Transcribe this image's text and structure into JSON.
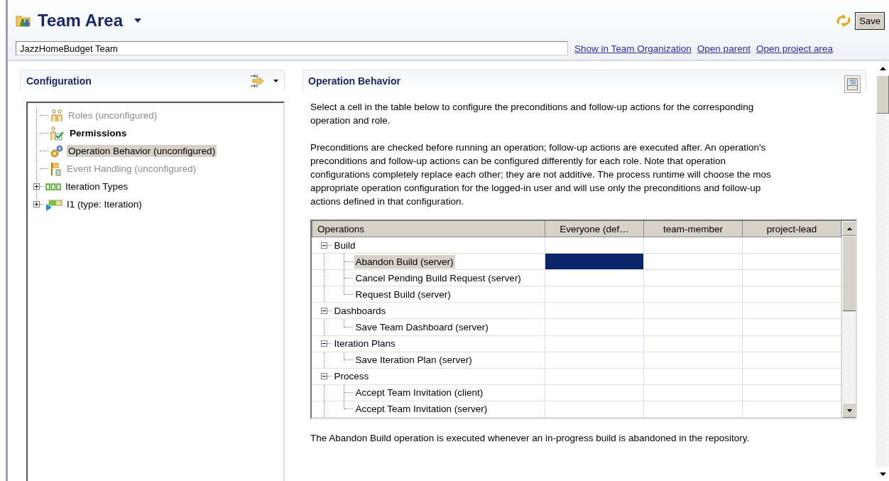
{
  "editor": {
    "title": "Team Area",
    "save_button": "Save",
    "name_field": {
      "value": "JazzHomeBudget Team"
    },
    "links": [
      "Show in Team Organization",
      "Open parent",
      "Open project area"
    ]
  },
  "configuration": {
    "title": "Configuration",
    "tree": [
      {
        "label": "Roles (unconfigured)",
        "kind": "roles",
        "disabled": true,
        "bold": false,
        "selected": false
      },
      {
        "label": "Permissions",
        "kind": "permissions",
        "disabled": false,
        "bold": true,
        "selected": false
      },
      {
        "label": "Operation Behavior (unconfigured)",
        "kind": "operations",
        "disabled": false,
        "bold": false,
        "selected": true
      },
      {
        "label": "Event Handling (unconfigured)",
        "kind": "events",
        "disabled": true,
        "bold": false,
        "selected": false
      },
      {
        "label": "Iteration Types",
        "kind": "iteration-types",
        "disabled": false,
        "bold": false,
        "selected": false,
        "expanded": false
      },
      {
        "label": "I1 (type: Iteration)",
        "kind": "iteration",
        "disabled": false,
        "bold": false,
        "selected": false,
        "expanded": false
      }
    ]
  },
  "operation_behavior": {
    "title": "Operation Behavior",
    "intro": [
      "Select a cell in the table below to configure the preconditions and follow-up actions for the corresponding",
      " operation and role."
    ],
    "details": [
      "Preconditions are checked before running an operation; follow-up actions are executed after. An operation's",
      " preconditions and follow-up actions can be configured differently for each role. Note that operation",
      " configurations completely replace each other; they are not additive. The process runtime will choose the mos",
      " appropriate operation configuration for the logged-in user and will use only the preconditions and follow-up",
      " actions defined in that configuration."
    ],
    "table": {
      "columns": [
        "Operations",
        "Everyone (def…",
        "team-member",
        "project-lead"
      ],
      "rows": [
        {
          "label": "Build",
          "expanded": true,
          "selected": false,
          "cells": [
            {
              "selected": false
            },
            {
              "selected": false
            },
            {
              "selected": false
            }
          ],
          "children": [
            {
              "label": "Abandon Build (server)",
              "selected": true,
              "cells": [
                {
                  "selected": true
                },
                {
                  "selected": false
                },
                {
                  "selected": false
                }
              ]
            },
            {
              "label": "Cancel Pending Build Request (server)",
              "selected": false,
              "cells": [
                {
                  "selected": false
                },
                {
                  "selected": false
                },
                {
                  "selected": false
                }
              ]
            },
            {
              "label": "Request Build (server)",
              "selected": false,
              "cells": [
                {
                  "selected": false
                },
                {
                  "selected": false
                },
                {
                  "selected": false
                }
              ]
            }
          ]
        },
        {
          "label": "Dashboards",
          "expanded": true,
          "selected": false,
          "cells": [
            {
              "selected": false
            },
            {
              "selected": false
            },
            {
              "selected": false
            }
          ],
          "children": [
            {
              "label": "Save Team Dashboard (server)",
              "selected": false,
              "cells": [
                {
                  "selected": false
                },
                {
                  "selected": false
                },
                {
                  "selected": false
                }
              ]
            }
          ]
        },
        {
          "label": "Iteration Plans",
          "expanded": true,
          "selected": false,
          "cells": [
            {
              "selected": false
            },
            {
              "selected": false
            },
            {
              "selected": false
            }
          ],
          "children": [
            {
              "label": "Save Iteration Plan (server)",
              "selected": false,
              "cells": [
                {
                  "selected": false
                },
                {
                  "selected": false
                },
                {
                  "selected": false
                }
              ]
            }
          ]
        },
        {
          "label": "Process",
          "expanded": true,
          "selected": false,
          "cells": [
            {
              "selected": false
            },
            {
              "selected": false
            },
            {
              "selected": false
            }
          ],
          "children": [
            {
              "label": "Accept Team Invitation (client)",
              "selected": false,
              "cells": [
                {
                  "selected": false
                },
                {
                  "selected": false
                },
                {
                  "selected": false
                }
              ]
            },
            {
              "label": "Accept Team Invitation (server)",
              "selected": false,
              "cells": [
                {
                  "selected": false
                },
                {
                  "selected": false
                },
                {
                  "selected": false
                }
              ]
            }
          ]
        }
      ]
    },
    "description": "The Abandon Build operation is executed whenever an in-progress build is abandoned in the repository."
  }
}
